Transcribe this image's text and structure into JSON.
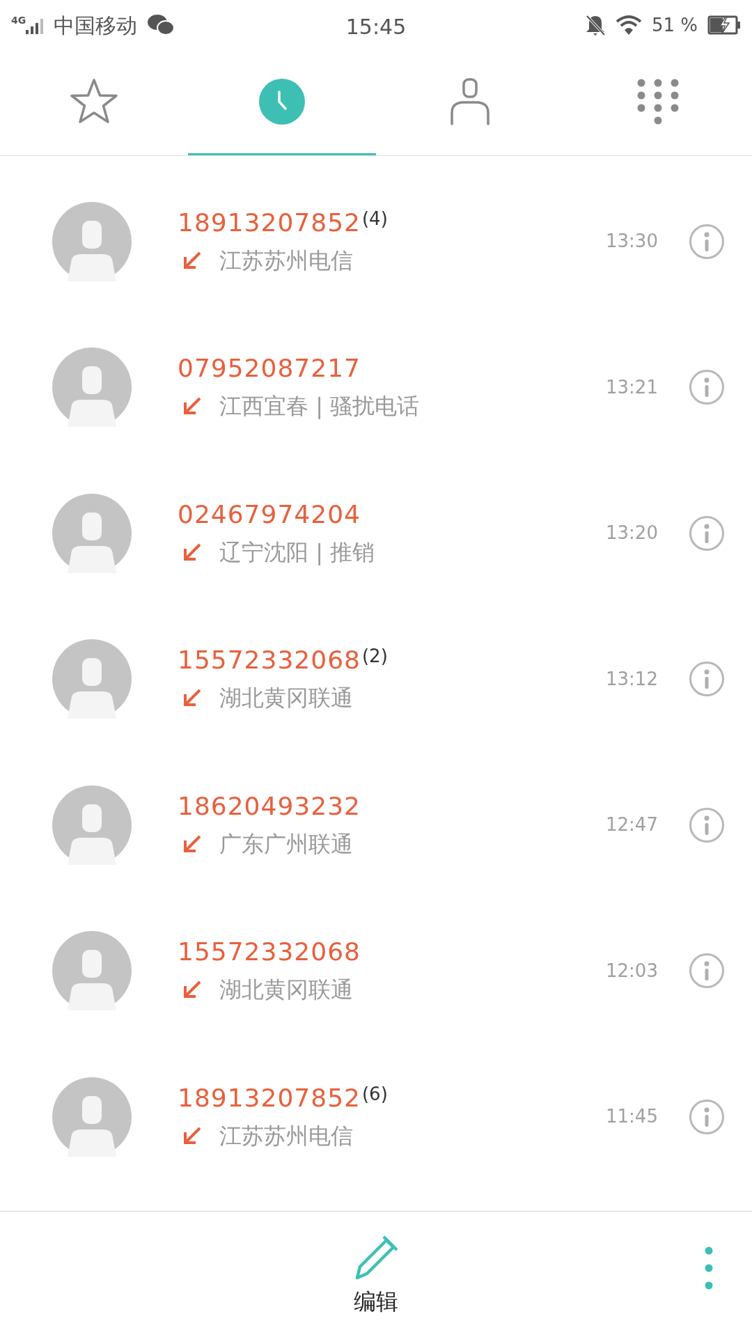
{
  "status_bar": {
    "network": "4G",
    "carrier": "中国移动",
    "time": "15:45",
    "battery": "51 %"
  },
  "tabs": [
    {
      "kind": "favorites",
      "selected": false
    },
    {
      "kind": "recents",
      "selected": true
    },
    {
      "kind": "contacts",
      "selected": false
    },
    {
      "kind": "dialpad",
      "selected": false
    }
  ],
  "calls": [
    {
      "number": "18913207852",
      "count": "(4)",
      "location": "江苏苏州电信",
      "time": "13:30"
    },
    {
      "number": "07952087217",
      "location": "江西宜春 | 骚扰电话",
      "time": "13:21"
    },
    {
      "number": "02467974204",
      "location": "辽宁沈阳 | 推销",
      "time": "13:20"
    },
    {
      "number": "15572332068",
      "count": "(2)",
      "location": "湖北黄冈联通",
      "time": "13:12"
    },
    {
      "number": "18620493232",
      "location": "广东广州联通",
      "time": "12:47"
    },
    {
      "number": "15572332068",
      "location": "湖北黄冈联通",
      "time": "12:03"
    },
    {
      "number": "18913207852",
      "count": "(6)",
      "location": "江苏苏州电信",
      "time": "11:45"
    }
  ],
  "bottom_bar": {
    "edit_label": "编辑"
  }
}
